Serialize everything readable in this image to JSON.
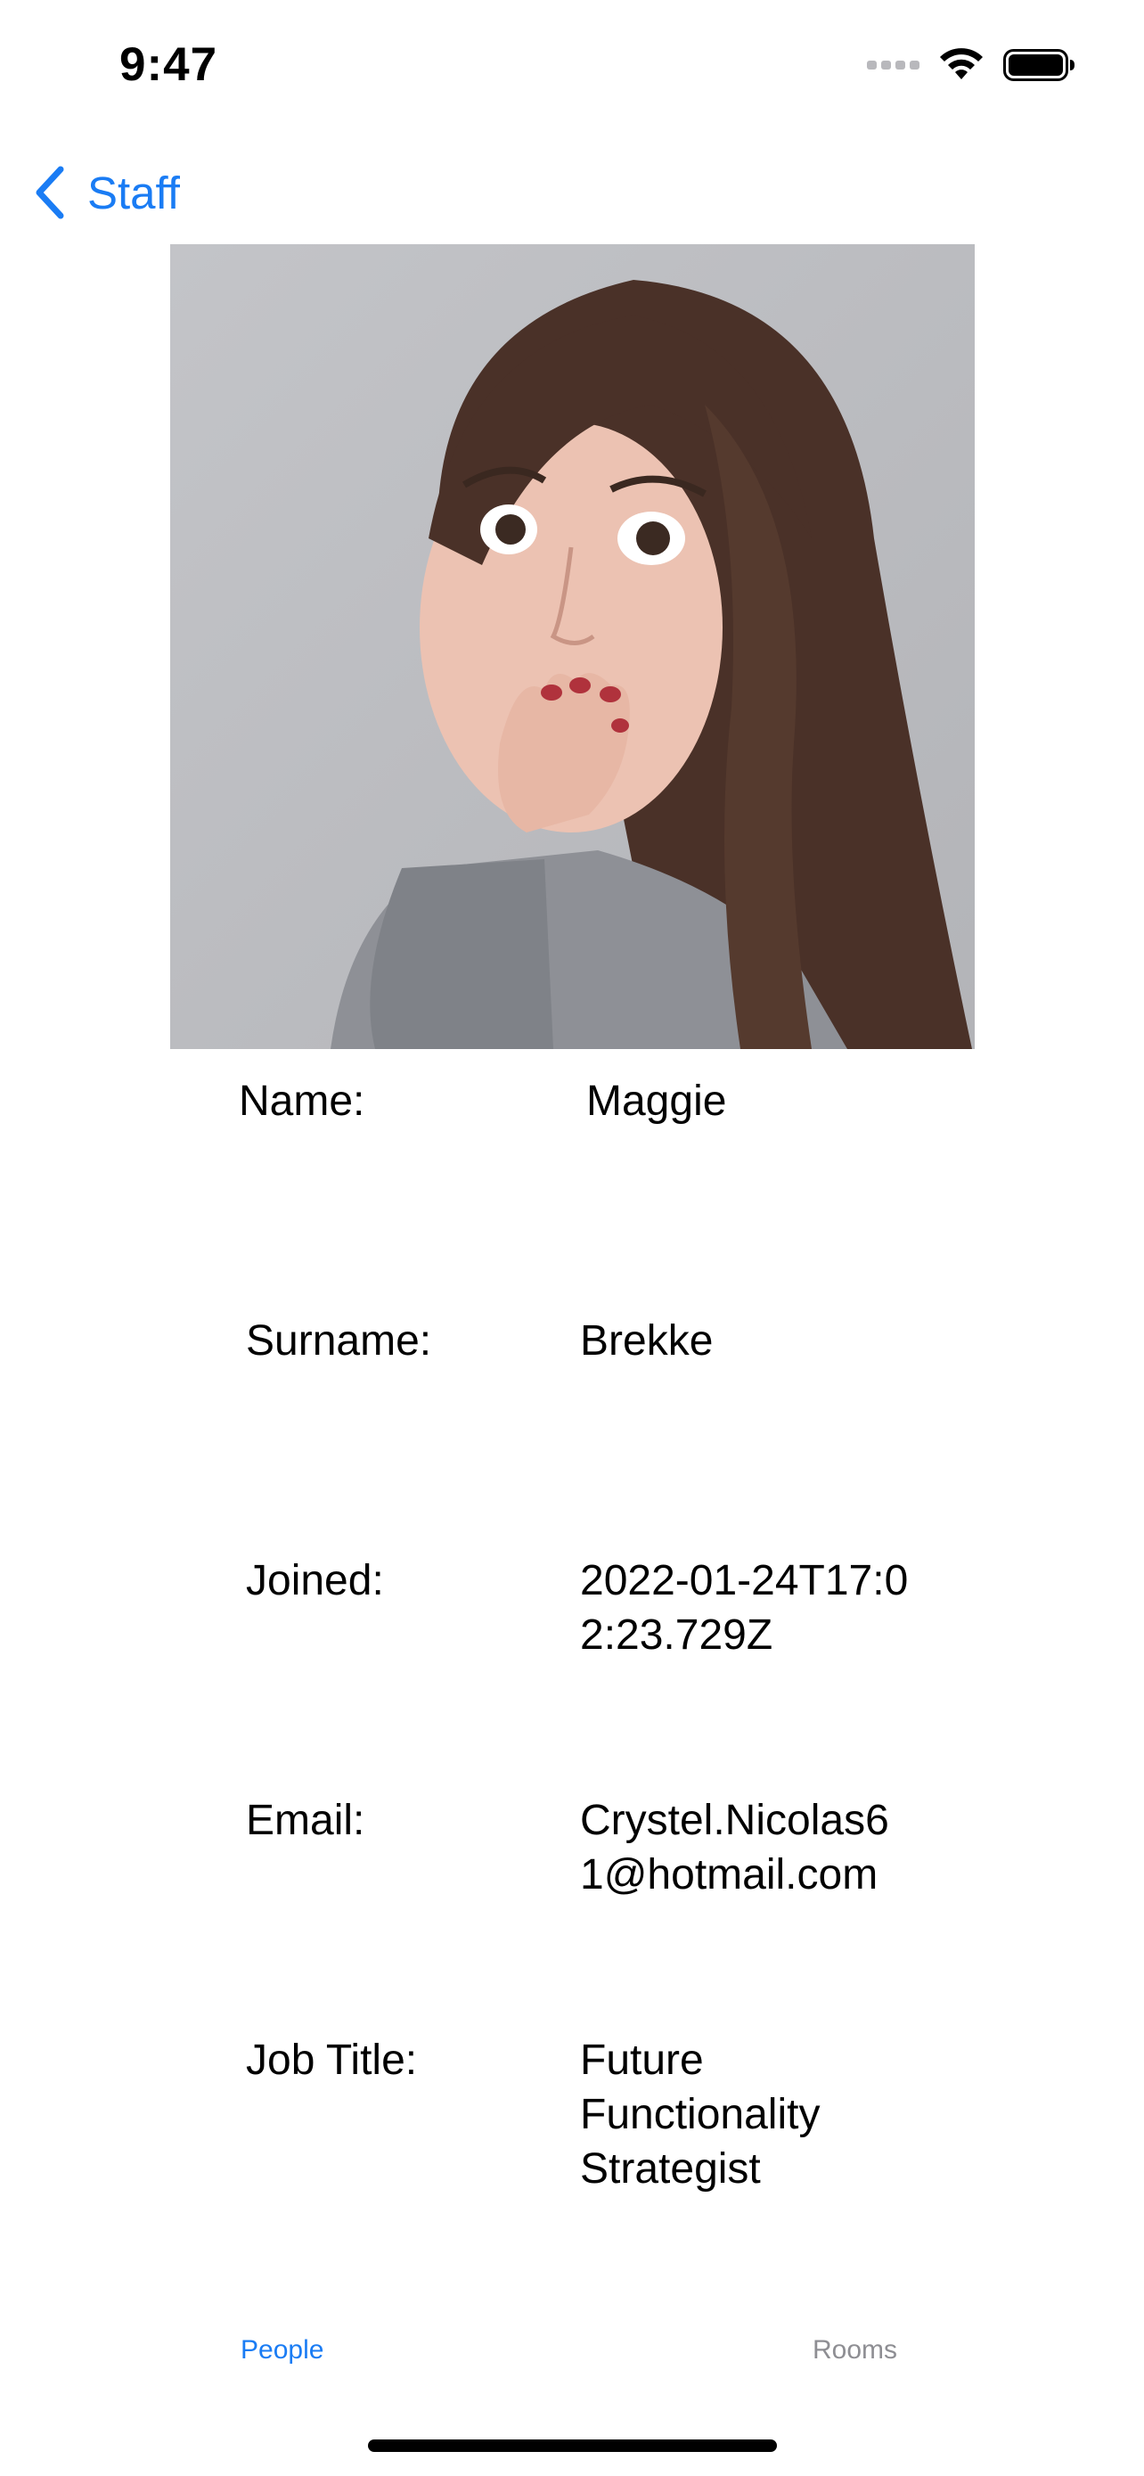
{
  "status_bar": {
    "time": "9:47",
    "icons": [
      "cellular-signal-icon",
      "wifi-icon",
      "battery-icon"
    ]
  },
  "nav": {
    "back_label": "Staff",
    "back_icon": "chevron-left-icon",
    "accent_color": "#1a7cf4"
  },
  "profile": {
    "photo_icon": "profile-photo",
    "fields": [
      {
        "label": "Name:",
        "value": "Maggie"
      },
      {
        "label": "Surname:",
        "value": "Brekke"
      },
      {
        "label": "Joined:",
        "value": "2022-01-24T17:02:23.729Z"
      },
      {
        "label": "Email:",
        "value": "Crystel.Nicolas61@hotmail.com"
      },
      {
        "label": "Job Title:",
        "value": "Future Functionality Strategist"
      }
    ]
  },
  "tabs": [
    {
      "label": "People",
      "active": true
    },
    {
      "label": "Rooms",
      "active": false
    }
  ]
}
